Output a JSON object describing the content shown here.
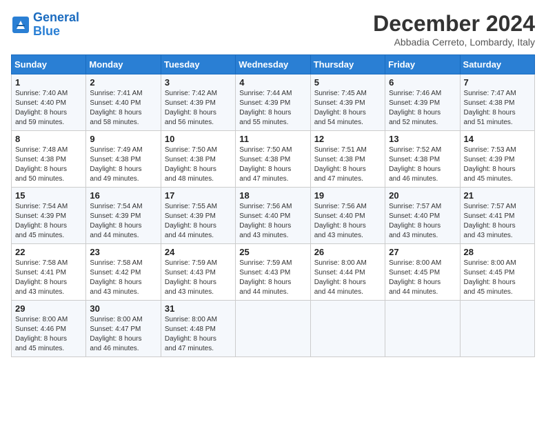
{
  "header": {
    "logo_line1": "General",
    "logo_line2": "Blue",
    "month_title": "December 2024",
    "location": "Abbadia Cerreto, Lombardy, Italy"
  },
  "days_of_week": [
    "Sunday",
    "Monday",
    "Tuesday",
    "Wednesday",
    "Thursday",
    "Friday",
    "Saturday"
  ],
  "weeks": [
    [
      {
        "day": "1",
        "info": "Sunrise: 7:40 AM\nSunset: 4:40 PM\nDaylight: 8 hours\nand 59 minutes."
      },
      {
        "day": "2",
        "info": "Sunrise: 7:41 AM\nSunset: 4:40 PM\nDaylight: 8 hours\nand 58 minutes."
      },
      {
        "day": "3",
        "info": "Sunrise: 7:42 AM\nSunset: 4:39 PM\nDaylight: 8 hours\nand 56 minutes."
      },
      {
        "day": "4",
        "info": "Sunrise: 7:44 AM\nSunset: 4:39 PM\nDaylight: 8 hours\nand 55 minutes."
      },
      {
        "day": "5",
        "info": "Sunrise: 7:45 AM\nSunset: 4:39 PM\nDaylight: 8 hours\nand 54 minutes."
      },
      {
        "day": "6",
        "info": "Sunrise: 7:46 AM\nSunset: 4:39 PM\nDaylight: 8 hours\nand 52 minutes."
      },
      {
        "day": "7",
        "info": "Sunrise: 7:47 AM\nSunset: 4:38 PM\nDaylight: 8 hours\nand 51 minutes."
      }
    ],
    [
      {
        "day": "8",
        "info": "Sunrise: 7:48 AM\nSunset: 4:38 PM\nDaylight: 8 hours\nand 50 minutes."
      },
      {
        "day": "9",
        "info": "Sunrise: 7:49 AM\nSunset: 4:38 PM\nDaylight: 8 hours\nand 49 minutes."
      },
      {
        "day": "10",
        "info": "Sunrise: 7:50 AM\nSunset: 4:38 PM\nDaylight: 8 hours\nand 48 minutes."
      },
      {
        "day": "11",
        "info": "Sunrise: 7:50 AM\nSunset: 4:38 PM\nDaylight: 8 hours\nand 47 minutes."
      },
      {
        "day": "12",
        "info": "Sunrise: 7:51 AM\nSunset: 4:38 PM\nDaylight: 8 hours\nand 47 minutes."
      },
      {
        "day": "13",
        "info": "Sunrise: 7:52 AM\nSunset: 4:38 PM\nDaylight: 8 hours\nand 46 minutes."
      },
      {
        "day": "14",
        "info": "Sunrise: 7:53 AM\nSunset: 4:39 PM\nDaylight: 8 hours\nand 45 minutes."
      }
    ],
    [
      {
        "day": "15",
        "info": "Sunrise: 7:54 AM\nSunset: 4:39 PM\nDaylight: 8 hours\nand 45 minutes."
      },
      {
        "day": "16",
        "info": "Sunrise: 7:54 AM\nSunset: 4:39 PM\nDaylight: 8 hours\nand 44 minutes."
      },
      {
        "day": "17",
        "info": "Sunrise: 7:55 AM\nSunset: 4:39 PM\nDaylight: 8 hours\nand 44 minutes."
      },
      {
        "day": "18",
        "info": "Sunrise: 7:56 AM\nSunset: 4:40 PM\nDaylight: 8 hours\nand 43 minutes."
      },
      {
        "day": "19",
        "info": "Sunrise: 7:56 AM\nSunset: 4:40 PM\nDaylight: 8 hours\nand 43 minutes."
      },
      {
        "day": "20",
        "info": "Sunrise: 7:57 AM\nSunset: 4:40 PM\nDaylight: 8 hours\nand 43 minutes."
      },
      {
        "day": "21",
        "info": "Sunrise: 7:57 AM\nSunset: 4:41 PM\nDaylight: 8 hours\nand 43 minutes."
      }
    ],
    [
      {
        "day": "22",
        "info": "Sunrise: 7:58 AM\nSunset: 4:41 PM\nDaylight: 8 hours\nand 43 minutes."
      },
      {
        "day": "23",
        "info": "Sunrise: 7:58 AM\nSunset: 4:42 PM\nDaylight: 8 hours\nand 43 minutes."
      },
      {
        "day": "24",
        "info": "Sunrise: 7:59 AM\nSunset: 4:43 PM\nDaylight: 8 hours\nand 43 minutes."
      },
      {
        "day": "25",
        "info": "Sunrise: 7:59 AM\nSunset: 4:43 PM\nDaylight: 8 hours\nand 44 minutes."
      },
      {
        "day": "26",
        "info": "Sunrise: 8:00 AM\nSunset: 4:44 PM\nDaylight: 8 hours\nand 44 minutes."
      },
      {
        "day": "27",
        "info": "Sunrise: 8:00 AM\nSunset: 4:45 PM\nDaylight: 8 hours\nand 44 minutes."
      },
      {
        "day": "28",
        "info": "Sunrise: 8:00 AM\nSunset: 4:45 PM\nDaylight: 8 hours\nand 45 minutes."
      }
    ],
    [
      {
        "day": "29",
        "info": "Sunrise: 8:00 AM\nSunset: 4:46 PM\nDaylight: 8 hours\nand 45 minutes."
      },
      {
        "day": "30",
        "info": "Sunrise: 8:00 AM\nSunset: 4:47 PM\nDaylight: 8 hours\nand 46 minutes."
      },
      {
        "day": "31",
        "info": "Sunrise: 8:00 AM\nSunset: 4:48 PM\nDaylight: 8 hours\nand 47 minutes."
      },
      {
        "day": "",
        "info": ""
      },
      {
        "day": "",
        "info": ""
      },
      {
        "day": "",
        "info": ""
      },
      {
        "day": "",
        "info": ""
      }
    ]
  ]
}
